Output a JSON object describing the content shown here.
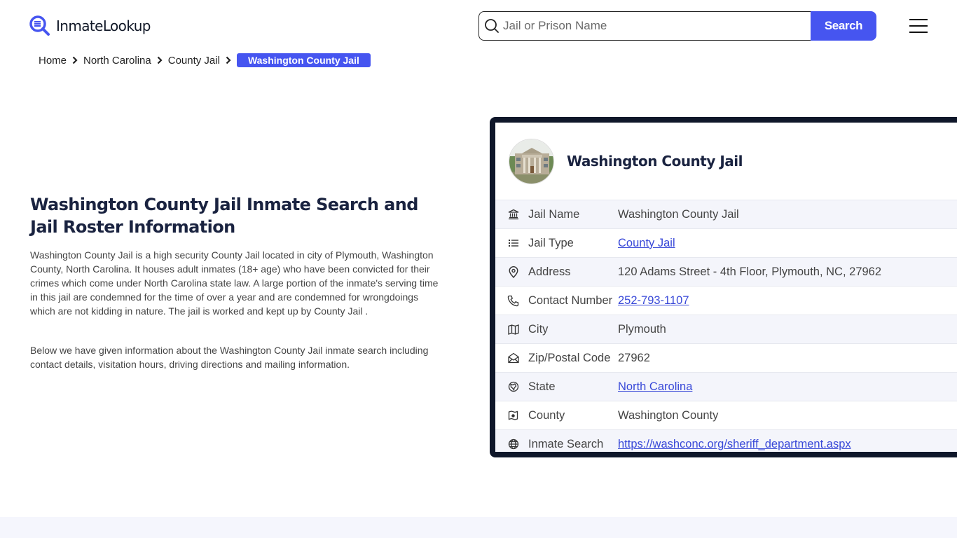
{
  "header": {
    "logo_text": "InmateLookup",
    "search_placeholder": "Jail or Prison Name",
    "search_value": "",
    "search_button": "Search",
    "accent_color": "#4655f0"
  },
  "breadcrumb": [
    {
      "label": "Home"
    },
    {
      "label": "North Carolina"
    },
    {
      "label": "County Jail"
    },
    {
      "label": "Washington County Jail",
      "active": true
    }
  ],
  "main": {
    "title": "Washington County Jail Inmate Search and Jail Roster Information",
    "paragraphs": [
      "Washington County Jail is a high security County Jail located in city of Plymouth, Washington County, North Carolina. It houses adult inmates (18+ age) who have been convicted for their crimes which come under North Carolina state law. A large portion of the inmate's serving time in this jail are condemned for the time of over a year and are condemned for wrongdoings which are not kidding in nature. The jail is worked and kept up by County Jail .",
      "Below we have given information about the Washington County Jail inmate search including contact details, visitation hours, driving directions and mailing information."
    ]
  },
  "card": {
    "title": "Washington County Jail",
    "image_alt": "courthouse-photo",
    "rows": [
      {
        "icon": "bank-icon",
        "label": "Jail Name",
        "value": "Washington County Jail",
        "link": false
      },
      {
        "icon": "list-icon",
        "label": "Jail Type",
        "value": "County Jail",
        "link": true
      },
      {
        "icon": "map-pin-icon",
        "label": "Address",
        "value": "120 Adams Street - 4th Floor, Plymouth, NC, 27962",
        "link": false
      },
      {
        "icon": "phone-icon",
        "label": "Contact Number",
        "value": "252-793-1107",
        "link": true
      },
      {
        "icon": "map-icon",
        "label": "City",
        "value": "Plymouth",
        "link": false
      },
      {
        "icon": "mail-open-icon",
        "label": "Zip/Postal Code",
        "value": "27962",
        "link": false
      },
      {
        "icon": "state-icon",
        "label": "State",
        "value": "North Carolina",
        "link": true
      },
      {
        "icon": "county-map-icon",
        "label": "County",
        "value": "Washington County",
        "link": false
      },
      {
        "icon": "globe-icon",
        "label": "Inmate Search",
        "value": "https://washconc.org/sheriff_department.aspx",
        "link": true
      }
    ]
  }
}
